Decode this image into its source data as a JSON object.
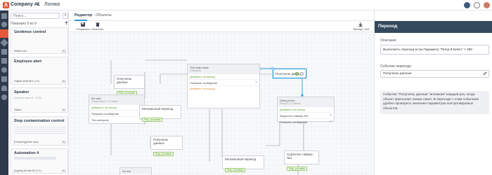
{
  "header": {
    "company": "Company #1",
    "page_title": "Логика"
  },
  "left_panel": {
    "search_placeholder": "Поиск ...",
    "shown_count": "Показано 9 из 9",
    "cards": [
      {
        "title": "Geofence control",
        "subtitle": "",
        "footer": "Watch car",
        "badge": "[1]"
      },
      {
        "title": "Employee alert",
        "subtitle": "",
        "footer": "Digital staff #01 (+1)",
        "badge": "[1]"
      },
      {
        "title": "Speaker",
        "subtitle": "Speaker speed - 2100",
        "footer": "Stand",
        "badge": "[1]"
      },
      {
        "title": "Stop contamination control",
        "subtitle": "",
        "footer": "[Cleaning] Bus stop",
        "badge": "[1]"
      },
      {
        "title": "Automation 4",
        "subtitle": "",
        "footer": "[Lights] Model 50 (+1)",
        "badge": "[1]"
      }
    ]
  },
  "tabs": [
    "Редактор",
    "Объекты"
  ],
  "toolbar": {
    "save": "Сохранить",
    "delete": "Очистить",
    "export": "Экспорт .dot"
  },
  "nodes": {
    "it_s_cold": {
      "title": "It's cold",
      "sub": "Temperature < 3 Celsius",
      "tag": "Добавить на выход",
      "row1": "Показать сообщение",
      "row2": "Тип контроль"
    },
    "recv1": {
      "title": "Получены данные",
      "tag": "Ред. условие"
    },
    "main": {
      "title": "The main node",
      "sub": "Описание",
      "tag1": "Добавить на выход",
      "row": "Показать сообщение",
      "tag2": "Добавить на выход"
    },
    "transition_sel": {
      "title": "Получены данны..."
    },
    "going_in": {
      "title": "Going in too",
      "sub": "Temp is 17 Celsius",
      "tag": "Добавить на выход",
      "row1": "Запустить таймер №1",
      "row2": "Показать сообщение"
    },
    "instant1": {
      "title": "Мгновенный переход",
      "tag": "Ред. условие"
    },
    "recv2": {
      "title": "Получены данные",
      "tag": "Ред. условие"
    },
    "instant2": {
      "title": "Мгновенный переход",
      "tag": "Ред. условие"
    },
    "timer": {
      "title": "Сработал таймер №1",
      "tag": "Ред. условие"
    },
    "go_too": {
      "title": "Go too"
    }
  },
  "right_panel": {
    "title": "Переход",
    "description_label": "Описание",
    "description_value": "Выполнить переход если Параметр \"Temp 8 kelvin\" > 350",
    "event_label": "Событие перехода",
    "event_value": "Получены данные",
    "note": "Событие \"Получены данные\" возникает каждый раз, когда объект присылает новые пакет. В переходе с этим событием удобно проверять значения параметров контролируемых объектов."
  }
}
